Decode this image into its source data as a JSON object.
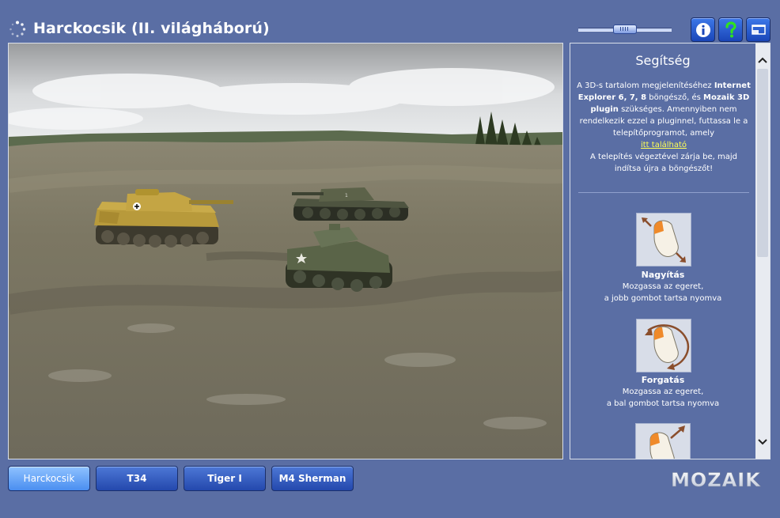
{
  "header": {
    "title": "Harckocsik (II. világháború)",
    "zoom_level": 0.5,
    "info_icon": "info-icon",
    "help_icon": "question-icon",
    "window_icon": "window-icon"
  },
  "help": {
    "title": "Segítség",
    "text_1": "A 3D-s tartalom megjelenítéséhez ",
    "bold_1": "Internet Explorer 6, 7, 8",
    "text_2": " böngésző, és ",
    "bold_2": "Mozaik 3D plugin",
    "text_3": " szükséges. Amennyiben nem rendelkezik ezzel a pluginnel, futtassa le a telepítőprogramot, amely",
    "link": "itt található",
    "text_4": "A telepítés végeztével zárja be, majd indítsa újra a böngészőt!",
    "hints": [
      {
        "title": "Nagyítás",
        "line1": "Mozgassa az egeret,",
        "line2": "a jobb gombot tartsa nyomva"
      },
      {
        "title": "Forgatás",
        "line1": "Mozgassa az egeret,",
        "line2": "a bal gombot tartsa nyomva"
      }
    ]
  },
  "tabs": [
    {
      "label": "Harckocsik",
      "active": true
    },
    {
      "label": "T34",
      "active": false
    },
    {
      "label": "Tiger I",
      "active": false
    },
    {
      "label": "M4 Sherman",
      "active": false
    }
  ],
  "logo": {
    "text": "MOZAIK"
  },
  "colors": {
    "background": "#5a6ea4",
    "button_blue": "#2448ad",
    "active_tab": "#4a8ef0",
    "link_yellow": "#ffff55"
  }
}
